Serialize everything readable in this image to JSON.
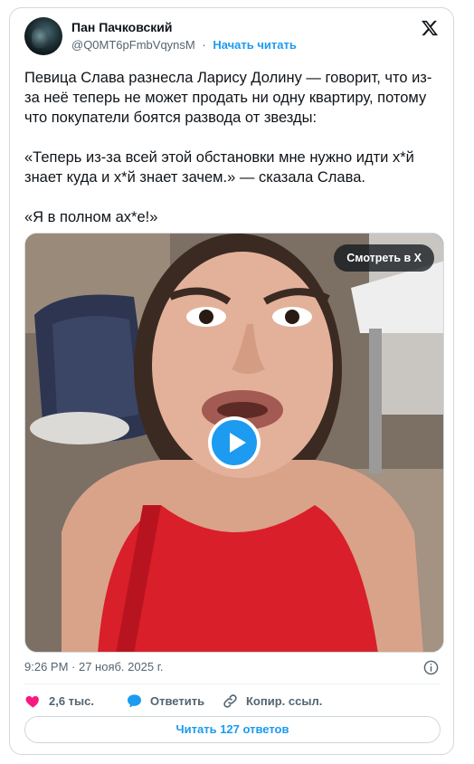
{
  "author": {
    "name": "Пан Пачковский",
    "handle": "@Q0MT6pFmbVqynsM",
    "separator": "·",
    "follow_label": "Начать читать"
  },
  "tweet": {
    "paragraphs": [
      "Певица Слава разнесла Ларису Долину — говорит, что из-за неё теперь не может продать ни одну квартиру, потому что покупатели боятся развода от звезды:",
      "«Теперь из-за всей этой обстановки мне нужно идти х*й знает куда и х*й знает зачем.» — сказала Слава.",
      "«Я в полном ах*е!»"
    ]
  },
  "media": {
    "watch_label": "Смотреть в X"
  },
  "meta": {
    "timestamp": "9:26 PM · 27 нояб. 2025 г."
  },
  "actions": {
    "like_count": "2,6 тыс.",
    "reply_label": "Ответить",
    "copy_label": "Копир. ссыл."
  },
  "read_replies_label": "Читать 127 ответов",
  "colors": {
    "accent": "#1d9bf0",
    "like": "#f91880",
    "text_secondary": "#536471"
  },
  "icons": [
    "x-logo-icon",
    "play-icon",
    "info-icon",
    "heart-icon",
    "reply-bubble-icon",
    "link-icon"
  ]
}
